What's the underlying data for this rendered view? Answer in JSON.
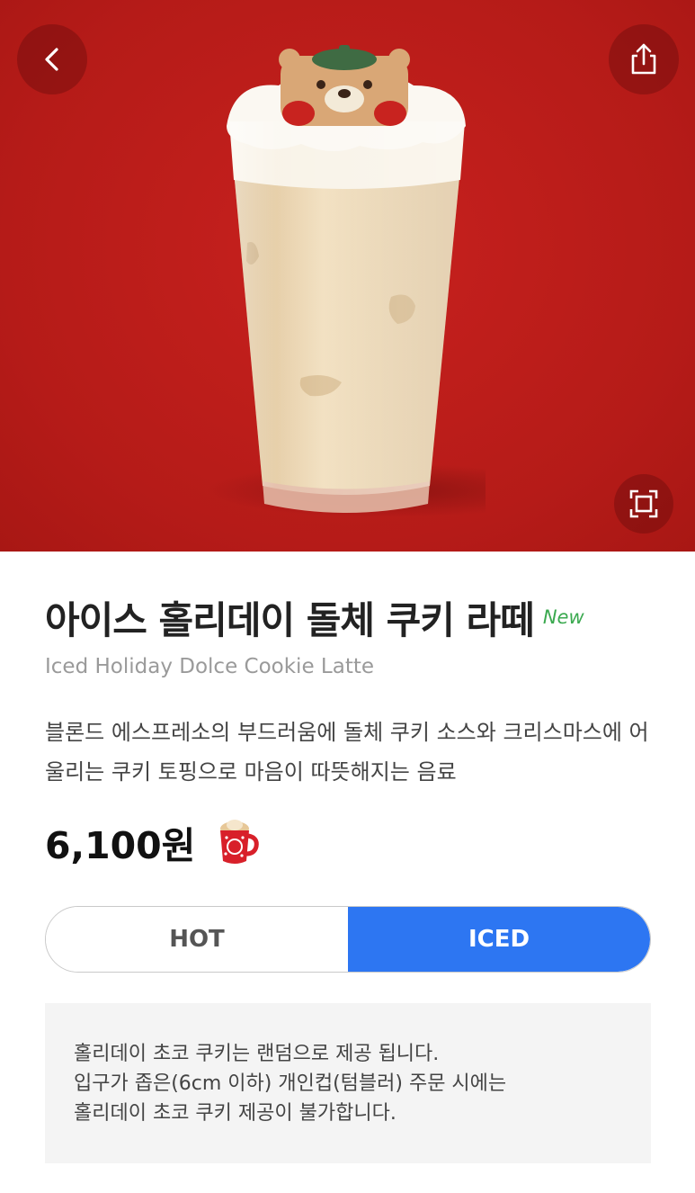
{
  "hero": {
    "background_color": "#b51b18",
    "back_icon": "chevron-left-icon",
    "share_icon": "share-icon",
    "zoom_icon": "fullscreen-icon"
  },
  "product": {
    "name_ko": "아이스 홀리데이 돌체 쿠키 라떼",
    "badge": "New",
    "name_en": "Iced Holiday Dolce Cookie Latte",
    "description": "블론드 에스프레소의 부드러움에 돌체 쿠키 소스와 크리스마스에 어울리는 쿠키 토핑으로 마음이 따뜻해지는 음료",
    "price": "6,100원",
    "badge_color": "#3aa94f"
  },
  "temperature": {
    "options": [
      "HOT",
      "ICED"
    ],
    "selected": "ICED",
    "accent_color": "#2d76f2"
  },
  "notice": {
    "lines": [
      "홀리데이 초코 쿠키는 랜덤으로 제공 됩니다.",
      "입구가 좁은(6cm 이하) 개인컵(텀블러) 주문 시에는",
      "홀리데이 초코 쿠키 제공이 불가합니다."
    ]
  }
}
